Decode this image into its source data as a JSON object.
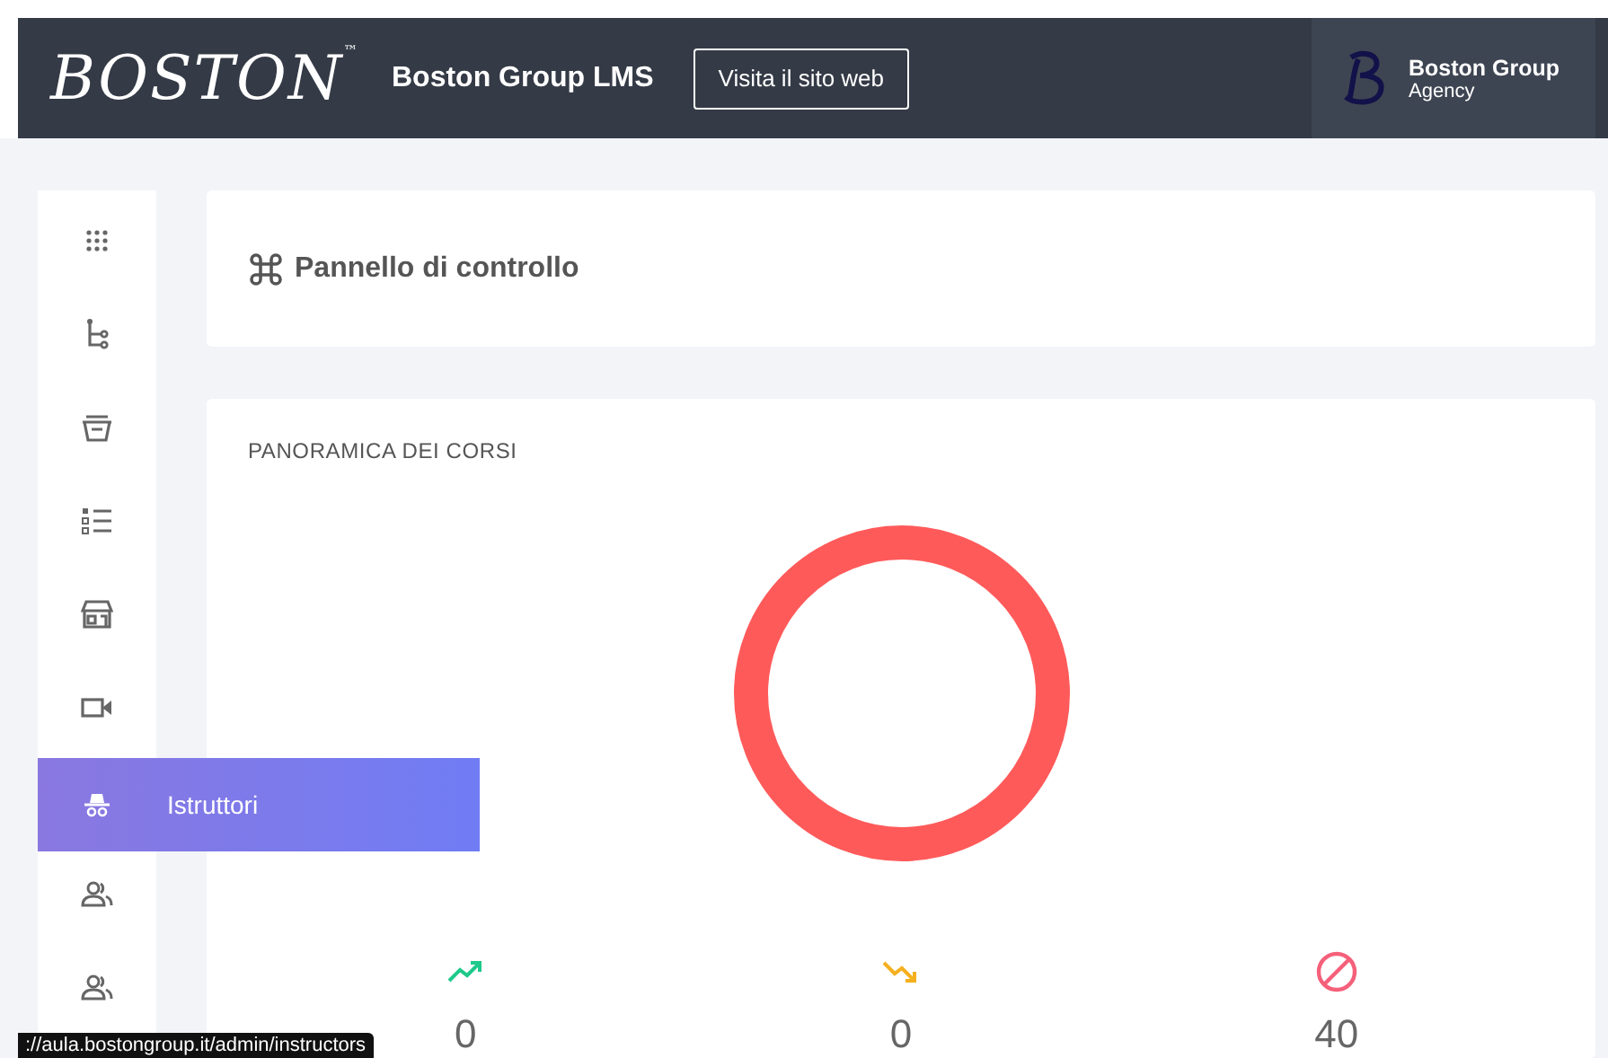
{
  "header": {
    "logo": "BOSTON",
    "logo_mark": "™",
    "app_title": "Boston Group LMS",
    "site_button": "Visita il sito web",
    "user": {
      "name": "Boston Group",
      "role": "Agency"
    }
  },
  "sidebar": {
    "items": [
      {
        "kind": "grid",
        "selected": false
      },
      {
        "kind": "tree",
        "selected": false
      },
      {
        "kind": "basket",
        "selected": false
      },
      {
        "kind": "list",
        "selected": false
      },
      {
        "kind": "store",
        "selected": false
      },
      {
        "kind": "video",
        "selected": false
      },
      {
        "kind": "instructor",
        "selected": true,
        "label": "Istruttori"
      },
      {
        "kind": "users",
        "selected": false
      },
      {
        "kind": "users",
        "selected": false
      }
    ]
  },
  "page_title": "Pannello di controllo",
  "overview": {
    "title": "PANORAMICA DEI CORSI",
    "stats": [
      {
        "kind": "up",
        "value": "0"
      },
      {
        "kind": "down",
        "value": "0"
      },
      {
        "kind": "blocked",
        "value": "40"
      }
    ]
  },
  "status_bar": {
    "url": "://aula.bostongroup.it/admin/instructors"
  }
}
